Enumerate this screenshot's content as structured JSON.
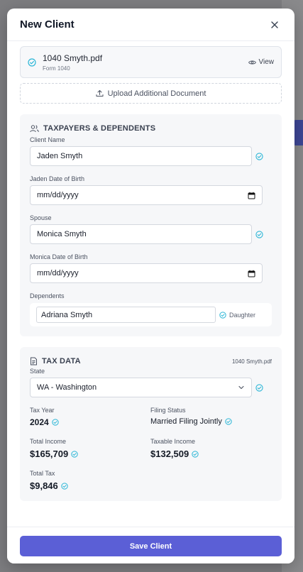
{
  "modal": {
    "title": "New Client",
    "save_label": "Save Client"
  },
  "document": {
    "file_name": "1040 Smyth.pdf",
    "file_type": "Form 1040",
    "view_label": "View",
    "upload_label": "Upload Additional Document"
  },
  "taxpayers": {
    "section_title": "TAXPAYERS & DEPENDENTS",
    "client_name_label": "Client Name",
    "client_name_value": "Jaden Smyth",
    "client_dob_label": "Jaden Date of Birth",
    "client_dob_placeholder": "mm/dd/yyyy",
    "spouse_label": "Spouse",
    "spouse_value": "Monica Smyth",
    "spouse_dob_label": "Monica Date of Birth",
    "spouse_dob_placeholder": "mm/dd/yyyy",
    "dependents_label": "Dependents",
    "dependents": [
      {
        "name": "Adriana Smyth",
        "relationship": "Daughter"
      }
    ]
  },
  "tax_data": {
    "section_title": "TAX DATA",
    "source_file": "1040 Smyth.pdf",
    "state_label": "State",
    "state_value": "WA - Washington",
    "tax_year_label": "Tax Year",
    "tax_year_value": "2024",
    "filing_status_label": "Filing Status",
    "filing_status_value": "Married Filing Jointly",
    "total_income_label": "Total Income",
    "total_income_value": "$165,709",
    "taxable_income_label": "Taxable Income",
    "taxable_income_value": "$132,509",
    "total_tax_label": "Total Tax",
    "total_tax_value": "$9,846"
  },
  "colors": {
    "accent": "#5b5fd6",
    "verified_check": "#2bb6d6"
  },
  "icons": {
    "close": "close-icon",
    "verified": "verified-check-icon",
    "view": "eye-icon",
    "upload": "upload-icon",
    "people": "people-icon",
    "document": "document-icon",
    "calendar": "calendar-icon",
    "chevron": "chevron-down-icon"
  }
}
